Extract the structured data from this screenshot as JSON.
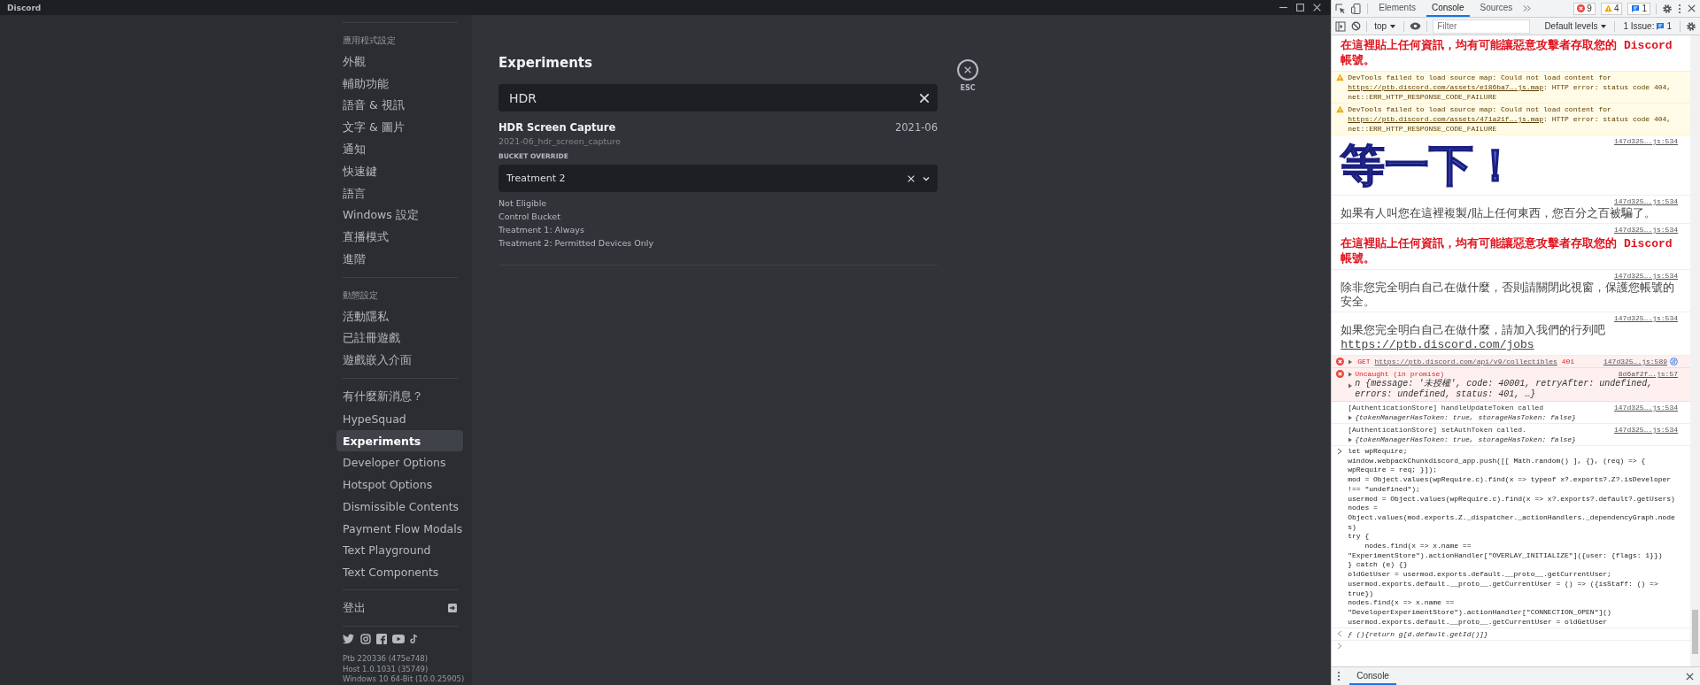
{
  "window": {
    "title": "Discord"
  },
  "sidebar": {
    "sections": [
      {
        "header": "應用程式設定",
        "items": [
          {
            "label": "外觀",
            "selected": false
          },
          {
            "label": "輔助功能",
            "selected": false
          },
          {
            "label": "語音 & 視訊",
            "selected": false
          },
          {
            "label": "文字 & 圖片",
            "selected": false
          },
          {
            "label": "通知",
            "selected": false
          },
          {
            "label": "快速鍵",
            "selected": false
          },
          {
            "label": "語言",
            "selected": false
          },
          {
            "label": "Windows 設定",
            "selected": false
          },
          {
            "label": "直播模式",
            "selected": false
          },
          {
            "label": "進階",
            "selected": false
          }
        ]
      },
      {
        "header": "動態設定",
        "items": [
          {
            "label": "活動隱私",
            "selected": false
          },
          {
            "label": "已註冊遊戲",
            "selected": false
          },
          {
            "label": "遊戲嵌入介面",
            "selected": false
          }
        ]
      },
      {
        "items": [
          {
            "label": "有什麼新消息？",
            "selected": false
          },
          {
            "label": "HypeSquad",
            "selected": false
          },
          {
            "label": "Experiments",
            "selected": true
          },
          {
            "label": "Developer Options",
            "selected": false
          },
          {
            "label": "Hotspot Options",
            "selected": false
          },
          {
            "label": "Dismissible Contents",
            "selected": false
          },
          {
            "label": "Payment Flow Modals",
            "selected": false
          },
          {
            "label": "Text Playground",
            "selected": false
          },
          {
            "label": "Text Components",
            "selected": false
          }
        ]
      }
    ],
    "logout": "登出",
    "version_lines": [
      "Ptb 220336 (475e748)",
      "Host 1.0.1031 (35749)",
      "Windows 10 64-Bit (10.0.25905)"
    ]
  },
  "experiments": {
    "title": "Experiments",
    "search": {
      "value": "HDR"
    },
    "results": [
      {
        "name": "HDR Screen Capture",
        "date": "2021-06",
        "id": "2021-06_hdr_screen_capture",
        "override_label": "BUCKET OVERRIDE",
        "override_value": "Treatment 2",
        "buckets": [
          "Not Eligible",
          "Control Bucket",
          "Treatment 1: Always",
          "Treatment 2: Permitted Devices Only"
        ]
      }
    ],
    "close_label": "ESC"
  },
  "devtools": {
    "tabs": [
      {
        "label": "Elements",
        "selected": false
      },
      {
        "label": "Console",
        "selected": true
      },
      {
        "label": "Sources",
        "selected": false
      }
    ],
    "error_count": "9",
    "warning_count": "4",
    "message_count": "1",
    "context": "top",
    "filter": {
      "placeholder": "Filter"
    },
    "levels": "Default levels",
    "issues": {
      "label": "1 Issue:",
      "count": "1"
    },
    "messages": [
      {
        "kind": "alert",
        "text": "在這裡貼上任何資訊，均有可能讓惡意攻擊者存取您的 Discord 帳號。"
      },
      {
        "kind": "warning",
        "text": "DevTools failed to load source map: Could not load content for ",
        "link": "https://ptb.discord.com/assets/e186ba7….js.map",
        "after": ": HTTP error: status code 404, net::ERR_HTTP_RESPONSE_CODE_FAILURE"
      },
      {
        "kind": "warning",
        "text": "DevTools failed to load source map: Could not load content for ",
        "link": "https://ptb.discord.com/assets/471a21f….js.map",
        "after": ": HTTP error: status code 404, net::ERR_HTTP_RESPONSE_CODE_FAILURE"
      },
      {
        "kind": "banner",
        "text": "等一下！",
        "source": "147d325….js:534"
      },
      {
        "kind": "notice",
        "text": "如果有人叫您在這裡複製/貼上任何東西，您百分之百被騙了。",
        "source": "147d325….js:534"
      },
      {
        "kind": "alert",
        "text": "在這裡貼上任何資訊，均有可能讓惡意攻擊者存取您的 Discord 帳號。",
        "source": "147d325….js:534"
      },
      {
        "kind": "notice",
        "text": "除非您完全明白自己在做什麼，否則請關閉此視窗，保護您帳號的安全。",
        "source": "147d325….js:534"
      },
      {
        "kind": "notice",
        "text": "如果您完全明白自己在做什麼，請加入我們的行列吧 ",
        "link": "https://ptb.discord.com/jobs",
        "source": "147d325….js:534"
      },
      {
        "kind": "network-error",
        "method": "GET",
        "link": "https://ptb.discord.com/api/v9/collectibles",
        "status": "401",
        "source": "147d325….js:589"
      },
      {
        "kind": "exception",
        "text": "Uncaught (in promise)",
        "detail": "n {message: '未授權', code: 40001, retryAfter: undefined, errors: undefined, status: 401, …}",
        "source": "8d6af2f….js:57"
      },
      {
        "kind": "log",
        "text": "[AuthenticationStore] handleUpdateToken called",
        "detail": "{tokenManagerHasToken: true, storageHasToken: false}",
        "source": "147d325….js:534"
      },
      {
        "kind": "log",
        "text": "[AuthenticationStore] setAuthToken called.",
        "detail": "{tokenManagerHasToken: true, storageHasToken: false}",
        "source": "147d325….js:534"
      },
      {
        "kind": "input",
        "code": "let wpRequire;\nwindow.webpackChunkdiscord_app.push([[ Math.random() ], {}, (req) => { wpRequire = req; }]);\nmod = Object.values(wpRequire.c).find(x => typeof x?.exports?.Z?.isDeveloper !== \"undefined\");\nusermod = Object.values(wpRequire.c).find(x => x?.exports?.default?.getUsers)\nnodes = Object.values(mod.exports.Z._dispatcher._actionHandlers._dependencyGraph.nodes)\ntry {\n    nodes.find(x => x.name == \"ExperimentStore\").actionHandler[\"OVERLAY_INITIALIZE\"]({user: {flags: 1}})\n} catch (e) {}\noldGetUser = usermod.exports.default.__proto__.getCurrentUser;\nusermod.exports.default.__proto__.getCurrentUser = () => ({isStaff: () => true})\nnodes.find(x => x.name == \"DeveloperExperimentStore\").actionHandler[\"CONNECTION_OPEN\"]()\nusermod.exports.default.__proto__.getCurrentUser = oldGetUser"
      },
      {
        "kind": "result",
        "text": "ƒ (){return g[d.default.getId()]}"
      }
    ],
    "drawer_tab": "Console"
  }
}
